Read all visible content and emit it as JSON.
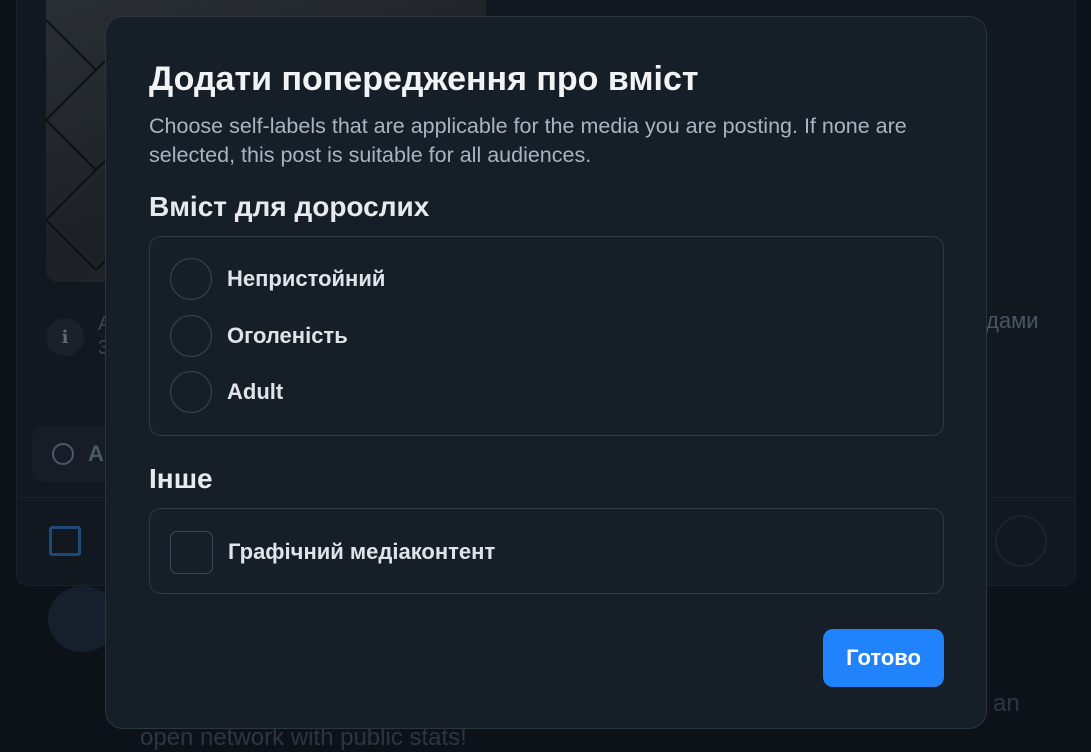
{
  "background": {
    "right_fragment": "дами",
    "bottom_text": "open network with public stats!",
    "right_bottom_fragment": "an",
    "alt_fragment": "A\n3",
    "lang_fragment": "A"
  },
  "modal": {
    "title": "Додати попередження про вміст",
    "description": "Choose self-labels that are applicable for the media you are posting. If none are selected, this post is suitable for all audiences.",
    "adult_section": {
      "title": "Вміст для дорослих",
      "options": [
        {
          "label": "Непристойний",
          "checked": false
        },
        {
          "label": "Оголеність",
          "checked": false
        },
        {
          "label": "Adult",
          "checked": false
        }
      ]
    },
    "other_section": {
      "title": "Інше",
      "options": [
        {
          "label": "Графічний медіаконтент",
          "checked": false
        }
      ]
    },
    "done_label": "Готово"
  },
  "colors": {
    "accent": "#2083fc",
    "modal_bg": "#161e27",
    "page_bg": "#0d1219"
  }
}
